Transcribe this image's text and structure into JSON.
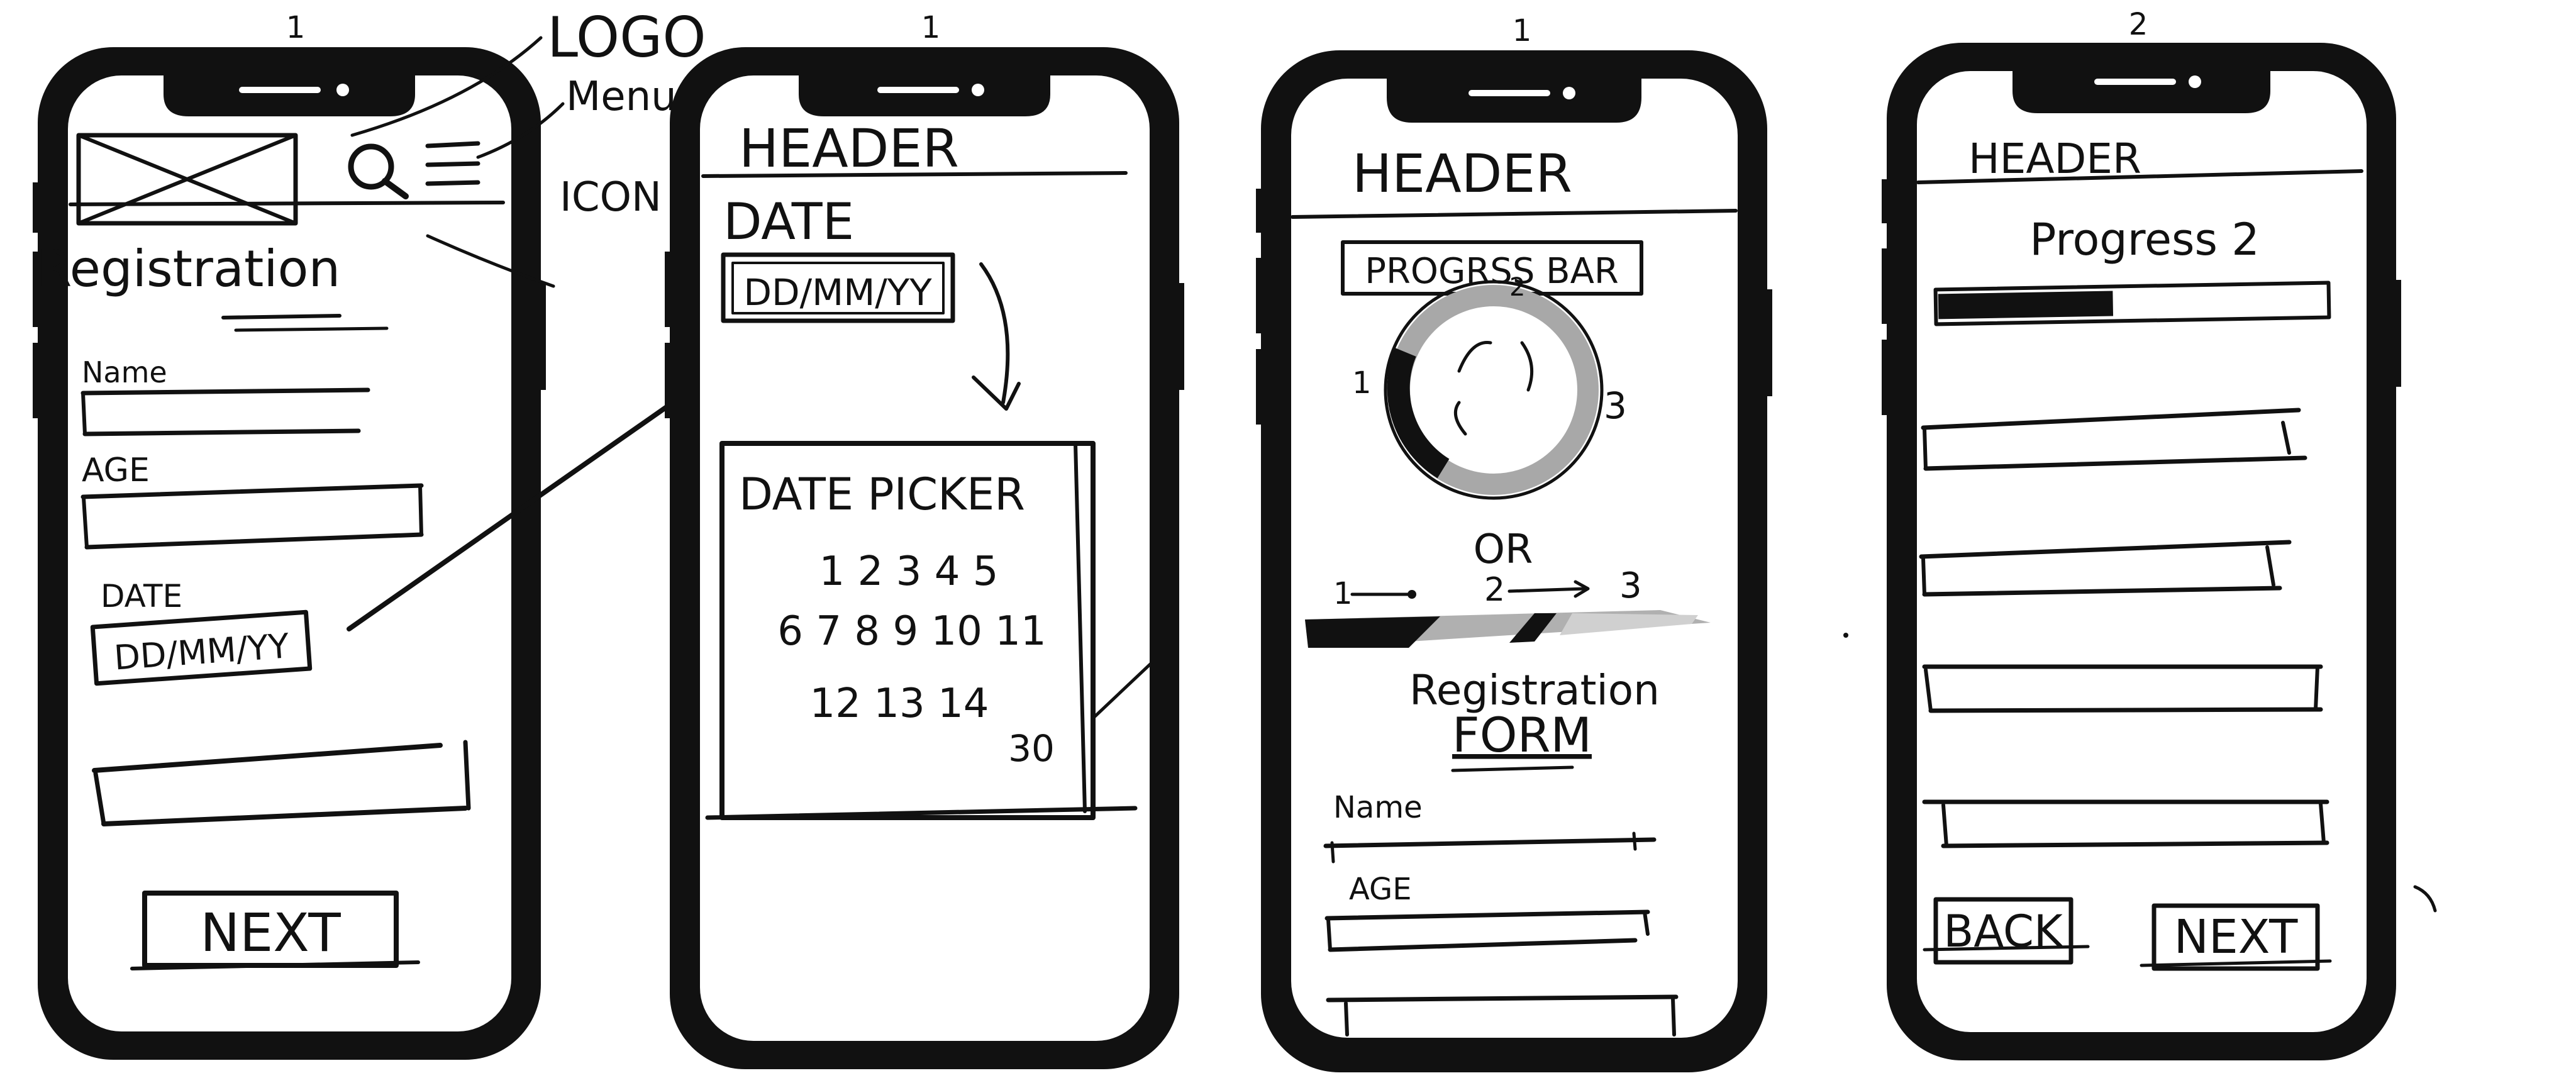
{
  "top_numbers": [
    "1",
    "1",
    "1",
    "2"
  ],
  "annotations": {
    "logo": "LOGO",
    "menu": "Menu",
    "icon": "ICON"
  },
  "phone1": {
    "title": "Registration",
    "name_label": "Name",
    "age_label": "AGE",
    "date_label": "DATE",
    "date_placeholder": "DD/MM/YY",
    "next_button": "NEXT"
  },
  "phone2": {
    "header": "HEADER",
    "date_label": "DATE",
    "date_placeholder": "DD/MM/YY",
    "picker_title": "DATE PICKER",
    "picker_rows": [
      "1 2 3  4 5",
      "6 7 8 9 10  11",
      "12  13  14",
      "30"
    ]
  },
  "phone3": {
    "header": "HEADER",
    "progress_label": "PROGRSS BAR",
    "circle_steps": [
      "1",
      "2",
      "3"
    ],
    "or_text": "OR",
    "linear_steps": [
      "1",
      "2",
      "3"
    ],
    "form_title_1": "Registration",
    "form_title_2": "FORM",
    "name_label": "Name",
    "age_label": "AGE"
  },
  "phone4": {
    "header": "HEADER",
    "progress_label": "Progress 2",
    "progress": 0.45,
    "back_button": "BACK",
    "next_button": "NEXT"
  }
}
